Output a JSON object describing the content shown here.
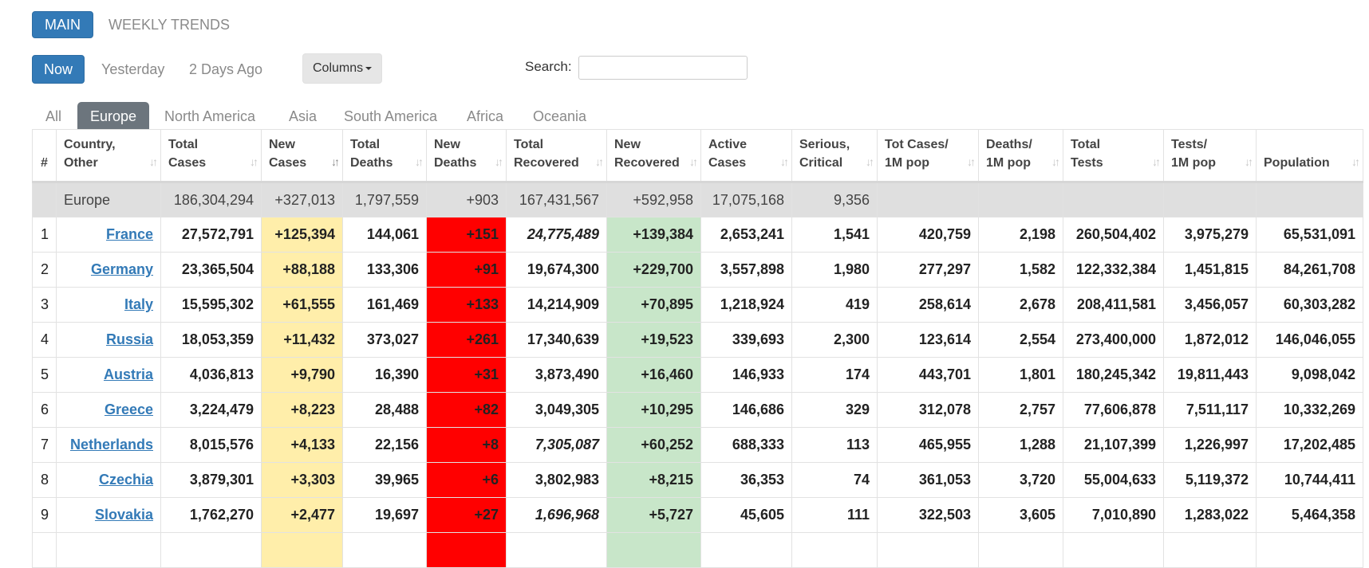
{
  "top_tabs": [
    {
      "label": "MAIN",
      "active": true
    },
    {
      "label": "WEEKLY TRENDS",
      "active": false
    }
  ],
  "day_tabs": [
    {
      "label": "Now",
      "active": true
    },
    {
      "label": "Yesterday",
      "active": false
    },
    {
      "label": "2 Days Ago",
      "active": false
    }
  ],
  "columns_label": "Columns",
  "search": {
    "label": "Search:",
    "value": ""
  },
  "region_tabs": [
    {
      "label": "All",
      "active": false
    },
    {
      "label": "Europe",
      "active": true
    },
    {
      "label": "North America",
      "active": false
    },
    {
      "label": "Asia",
      "active": false
    },
    {
      "label": "South America",
      "active": false
    },
    {
      "label": "Africa",
      "active": false
    },
    {
      "label": "Oceania",
      "active": false
    }
  ],
  "headers": [
    {
      "l1": "#",
      "l2": ""
    },
    {
      "l1": "Country,",
      "l2": "Other"
    },
    {
      "l1": "Total",
      "l2": "Cases"
    },
    {
      "l1": "New",
      "l2": "Cases"
    },
    {
      "l1": "Total",
      "l2": "Deaths"
    },
    {
      "l1": "New",
      "l2": "Deaths"
    },
    {
      "l1": "Total",
      "l2": "Recovered"
    },
    {
      "l1": "New",
      "l2": "Recovered"
    },
    {
      "l1": "Active",
      "l2": "Cases"
    },
    {
      "l1": "Serious,",
      "l2": "Critical"
    },
    {
      "l1": "Tot Cases/",
      "l2": "1M pop"
    },
    {
      "l1": "Deaths/",
      "l2": "1M pop"
    },
    {
      "l1": "Total",
      "l2": "Tests"
    },
    {
      "l1": "Tests/",
      "l2": "1M pop"
    },
    {
      "l1": "",
      "l2": "Population"
    }
  ],
  "total_row": {
    "country": "Europe",
    "total_cases": "186,304,294",
    "new_cases": "+327,013",
    "total_deaths": "1,797,559",
    "new_deaths": "+903",
    "total_recovered": "167,431,567",
    "new_recovered": "+592,958",
    "active_cases": "17,075,168",
    "serious": "9,356"
  },
  "rows": [
    {
      "rank": "1",
      "country": "France",
      "total_cases": "27,572,791",
      "new_cases": "+125,394",
      "total_deaths": "144,061",
      "new_deaths": "+151",
      "total_recovered": "24,775,489",
      "recovered_estimated": true,
      "new_recovered": "+139,384",
      "active_cases": "2,653,241",
      "serious": "1,541",
      "cases_per_m": "420,759",
      "deaths_per_m": "2,198",
      "total_tests": "260,504,402",
      "tests_per_m": "3,975,279",
      "population": "65,531,091"
    },
    {
      "rank": "2",
      "country": "Germany",
      "total_cases": "23,365,504",
      "new_cases": "+88,188",
      "total_deaths": "133,306",
      "new_deaths": "+91",
      "total_recovered": "19,674,300",
      "recovered_estimated": false,
      "new_recovered": "+229,700",
      "active_cases": "3,557,898",
      "serious": "1,980",
      "cases_per_m": "277,297",
      "deaths_per_m": "1,582",
      "total_tests": "122,332,384",
      "tests_per_m": "1,451,815",
      "population": "84,261,708"
    },
    {
      "rank": "3",
      "country": "Italy",
      "total_cases": "15,595,302",
      "new_cases": "+61,555",
      "total_deaths": "161,469",
      "new_deaths": "+133",
      "total_recovered": "14,214,909",
      "recovered_estimated": false,
      "new_recovered": "+70,895",
      "active_cases": "1,218,924",
      "serious": "419",
      "cases_per_m": "258,614",
      "deaths_per_m": "2,678",
      "total_tests": "208,411,581",
      "tests_per_m": "3,456,057",
      "population": "60,303,282"
    },
    {
      "rank": "4",
      "country": "Russia",
      "total_cases": "18,053,359",
      "new_cases": "+11,432",
      "total_deaths": "373,027",
      "new_deaths": "+261",
      "total_recovered": "17,340,639",
      "recovered_estimated": false,
      "new_recovered": "+19,523",
      "active_cases": "339,693",
      "serious": "2,300",
      "cases_per_m": "123,614",
      "deaths_per_m": "2,554",
      "total_tests": "273,400,000",
      "tests_per_m": "1,872,012",
      "population": "146,046,055"
    },
    {
      "rank": "5",
      "country": "Austria",
      "total_cases": "4,036,813",
      "new_cases": "+9,790",
      "total_deaths": "16,390",
      "new_deaths": "+31",
      "total_recovered": "3,873,490",
      "recovered_estimated": false,
      "new_recovered": "+16,460",
      "active_cases": "146,933",
      "serious": "174",
      "cases_per_m": "443,701",
      "deaths_per_m": "1,801",
      "total_tests": "180,245,342",
      "tests_per_m": "19,811,443",
      "population": "9,098,042"
    },
    {
      "rank": "6",
      "country": "Greece",
      "total_cases": "3,224,479",
      "new_cases": "+8,223",
      "total_deaths": "28,488",
      "new_deaths": "+82",
      "total_recovered": "3,049,305",
      "recovered_estimated": false,
      "new_recovered": "+10,295",
      "active_cases": "146,686",
      "serious": "329",
      "cases_per_m": "312,078",
      "deaths_per_m": "2,757",
      "total_tests": "77,606,878",
      "tests_per_m": "7,511,117",
      "population": "10,332,269"
    },
    {
      "rank": "7",
      "country": "Netherlands",
      "total_cases": "8,015,576",
      "new_cases": "+4,133",
      "total_deaths": "22,156",
      "new_deaths": "+8",
      "total_recovered": "7,305,087",
      "recovered_estimated": true,
      "new_recovered": "+60,252",
      "active_cases": "688,333",
      "serious": "113",
      "cases_per_m": "465,955",
      "deaths_per_m": "1,288",
      "total_tests": "21,107,399",
      "tests_per_m": "1,226,997",
      "population": "17,202,485"
    },
    {
      "rank": "8",
      "country": "Czechia",
      "total_cases": "3,879,301",
      "new_cases": "+3,303",
      "total_deaths": "39,965",
      "new_deaths": "+6",
      "total_recovered": "3,802,983",
      "recovered_estimated": false,
      "new_recovered": "+8,215",
      "active_cases": "36,353",
      "serious": "74",
      "cases_per_m": "361,053",
      "deaths_per_m": "3,720",
      "total_tests": "55,004,633",
      "tests_per_m": "5,119,372",
      "population": "10,744,411"
    },
    {
      "rank": "9",
      "country": "Slovakia",
      "total_cases": "1,762,270",
      "new_cases": "+2,477",
      "total_deaths": "19,697",
      "new_deaths": "+27",
      "total_recovered": "1,696,968",
      "recovered_estimated": true,
      "new_recovered": "+5,727",
      "active_cases": "45,605",
      "serious": "111",
      "cases_per_m": "322,503",
      "deaths_per_m": "3,605",
      "total_tests": "7,010,890",
      "tests_per_m": "1,283,022",
      "population": "5,464,358"
    },
    {
      "rank": "",
      "country": "",
      "total_cases": "",
      "new_cases": "",
      "total_deaths": "",
      "new_deaths": "",
      "total_recovered": "",
      "recovered_estimated": false,
      "new_recovered": "",
      "active_cases": "",
      "serious": "",
      "cases_per_m": "",
      "deaths_per_m": "",
      "total_tests": "",
      "tests_per_m": "",
      "population": ""
    }
  ],
  "colors": {
    "accent": "#337ab7",
    "new_cases_bg": "#ffeeaa",
    "new_deaths_bg": "#ff0000",
    "new_recovered_bg": "#c8e6c9",
    "total_row_bg": "#dfdfdf",
    "region_active_bg": "#6c757d"
  }
}
